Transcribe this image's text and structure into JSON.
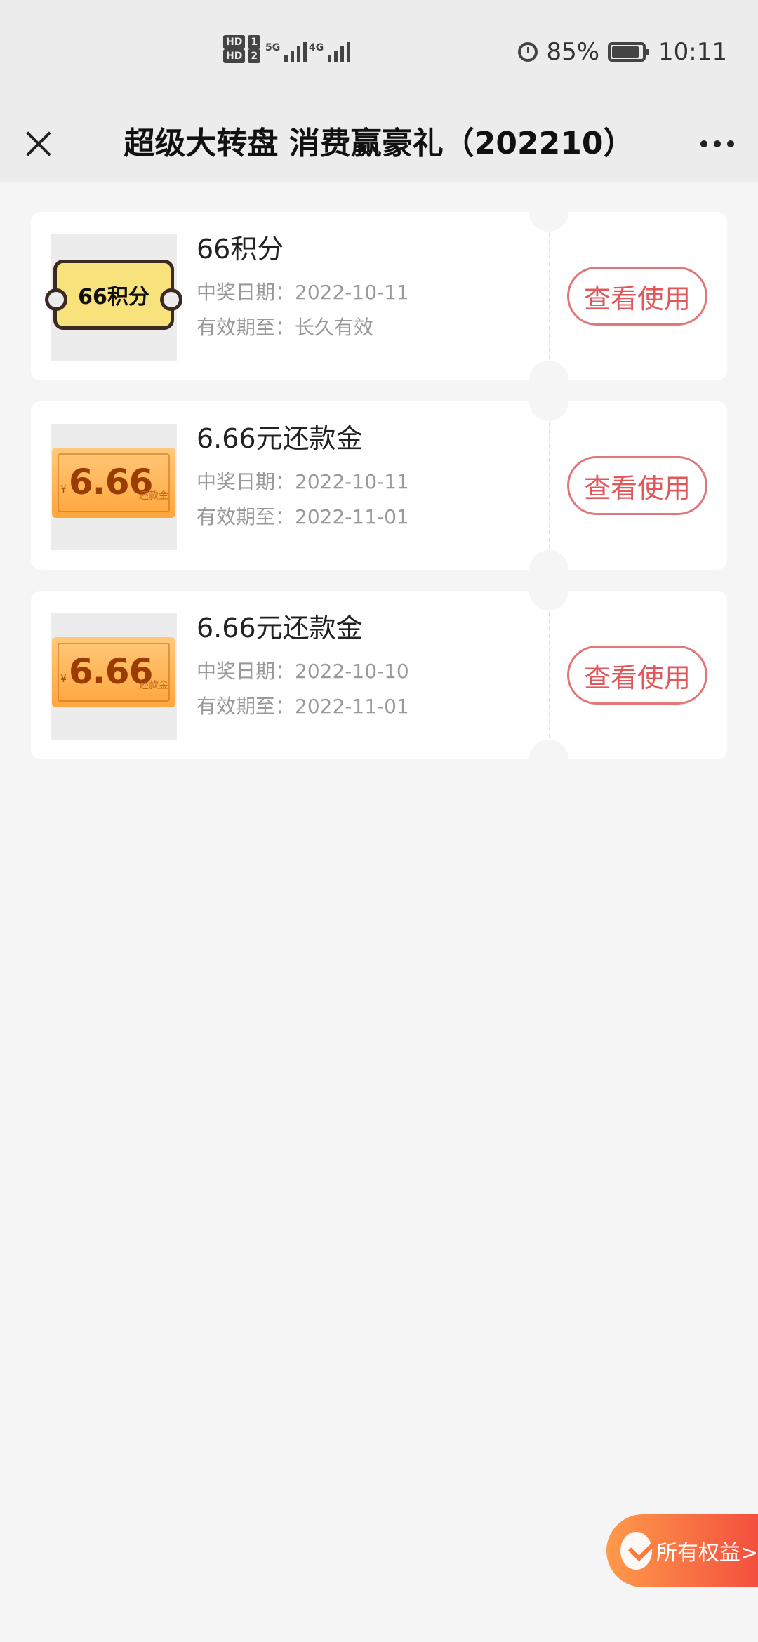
{
  "status_bar": {
    "hd1": "HD",
    "sim1": "1",
    "hd2": "HD",
    "sim2": "2",
    "net1": "5G",
    "net2": "4G",
    "battery": "85%",
    "time": "10:11"
  },
  "nav": {
    "title": "超级大转盘 消费赢豪礼（202210）"
  },
  "cards": [
    {
      "ticket_text": "66积分",
      "title": "66积分",
      "date_label": "中奖日期：",
      "date": "2022-10-11",
      "valid_label": "有效期至：",
      "valid": "长久有效",
      "button": "查看使用"
    },
    {
      "ticket_yen": "¥",
      "ticket_amount": "6.66",
      "ticket_sub": "还款金",
      "title": "6.66元还款金",
      "date_label": "中奖日期：",
      "date": "2022-10-11",
      "valid_label": "有效期至：",
      "valid": "2022-11-01",
      "button": "查看使用"
    },
    {
      "ticket_yen": "¥",
      "ticket_amount": "6.66",
      "ticket_sub": "还款金",
      "title": "6.66元还款金",
      "date_label": "中奖日期：",
      "date": "2022-10-10",
      "valid_label": "有效期至：",
      "valid": "2022-11-01",
      "button": "查看使用"
    }
  ],
  "floating": {
    "label": "所有权益>"
  }
}
